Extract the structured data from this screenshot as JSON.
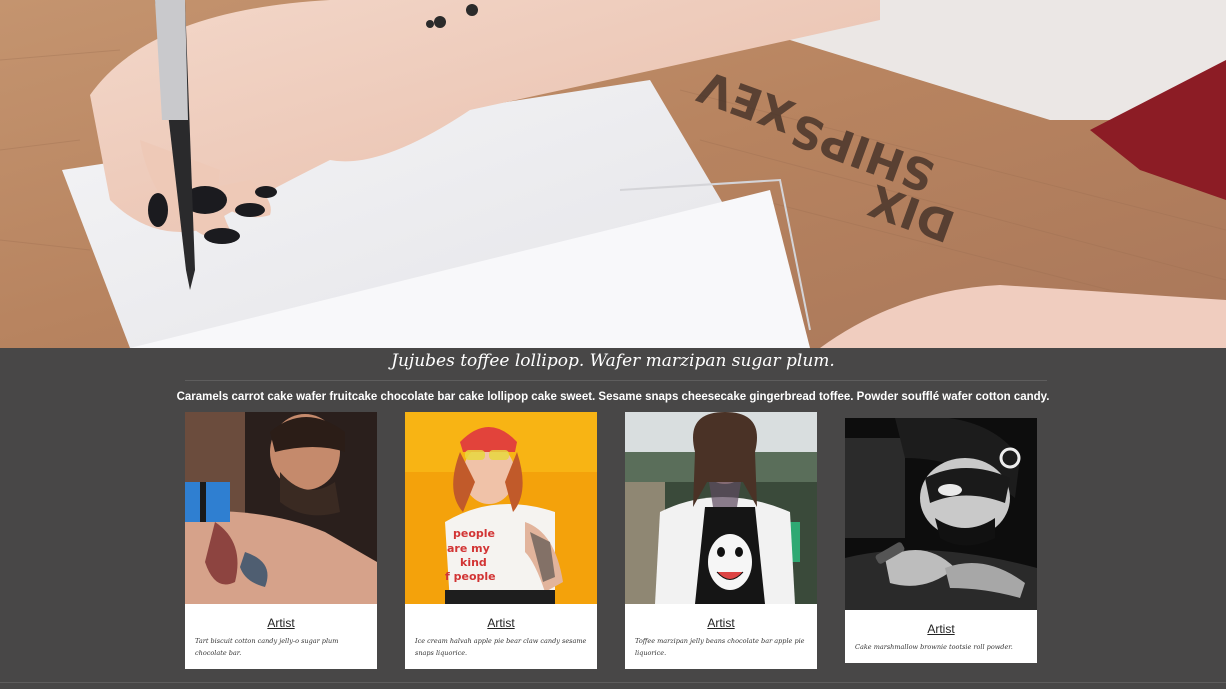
{
  "hero": {
    "image_description": "hand-writing-notebook-photo"
  },
  "tagline": "Jujubes toffee lollipop. Wafer marzipan sugar plum.",
  "description": "Caramels carrot cake wafer fruitcake chocolate bar cake lollipop cake sweet. Sesame snaps cheesecake gingerbread toffee. Powder soufflé wafer cotton candy.",
  "artists": [
    {
      "name": "Artist",
      "bio": "Tart biscuit cotton candy jelly-o sugar plum chocolate bar."
    },
    {
      "name": "Artist",
      "bio": "Ice cream halvah apple pie bear claw candy sesame snaps liquorice."
    },
    {
      "name": "Artist",
      "bio": "Toffee marzipan jelly beans chocolate bar apple pie liquorice."
    },
    {
      "name": "Artist",
      "bio": "Cake marshmallow brownie tootsie roll powder."
    }
  ],
  "colors": {
    "background": "#484747",
    "card": "#ffffff",
    "text_light": "#ffffff"
  }
}
